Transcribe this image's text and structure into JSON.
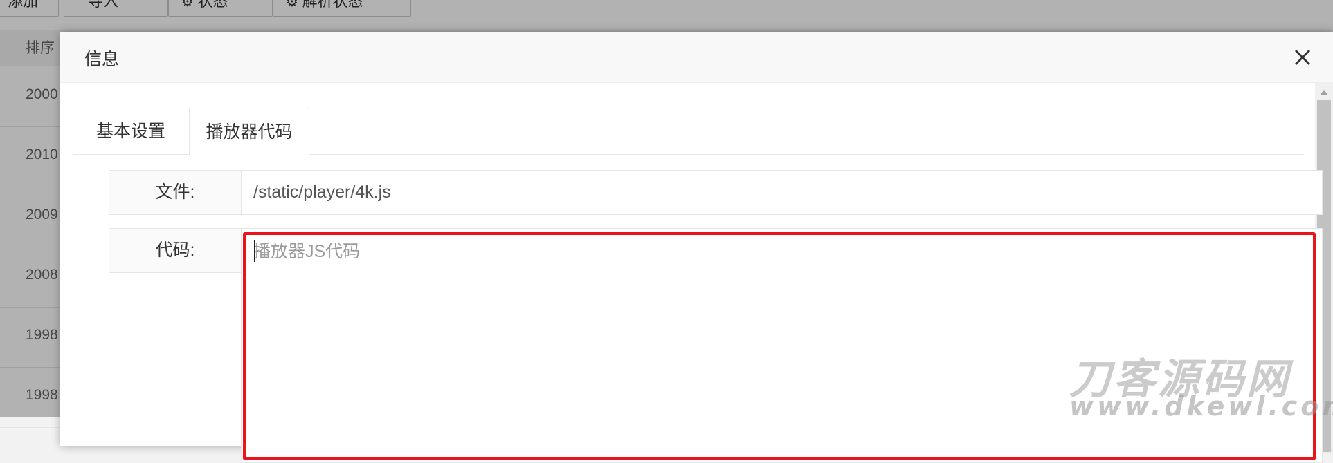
{
  "background": {
    "toolbar": {
      "buttons": [
        "添加",
        "导入",
        "状态",
        "解析状态"
      ]
    },
    "table": {
      "sort_header": "排序",
      "rows": [
        "2000",
        "2010",
        "2009",
        "2008",
        "1998",
        "1998"
      ]
    }
  },
  "modal": {
    "title": "信息",
    "tabs": [
      {
        "label": "基本设置",
        "active": false
      },
      {
        "label": "播放器代码",
        "active": true
      }
    ],
    "form": {
      "file_label": "文件:",
      "file_value": "/static/player/4k.js",
      "code_label": "代码:",
      "code_placeholder": "播放器JS代码"
    }
  },
  "watermark": {
    "title": "刀客源码网",
    "url": "www.dkewl.com"
  },
  "colors": {
    "highlight": "#e8161a",
    "overlay": "rgba(0,0,0,0.3)"
  }
}
